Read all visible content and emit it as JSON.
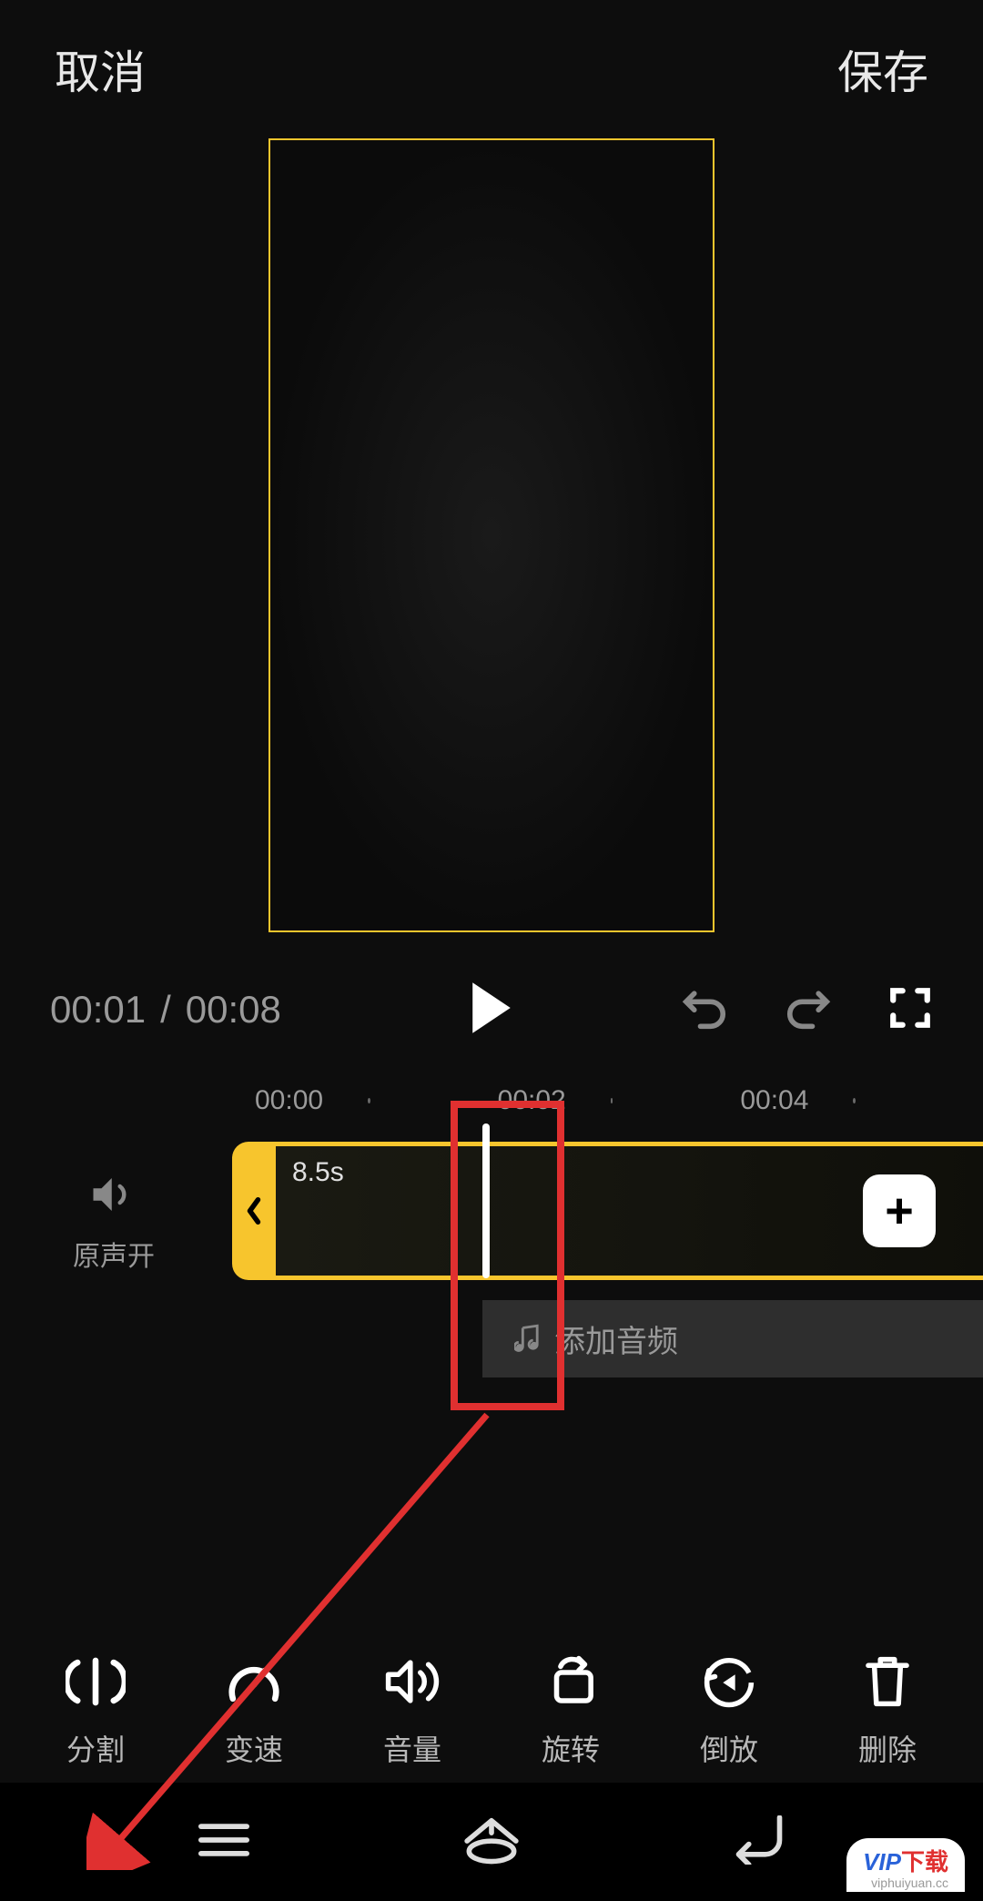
{
  "header": {
    "cancel": "取消",
    "save": "保存"
  },
  "playback": {
    "current_time": "00:01",
    "separator": "/",
    "total_time": "00:08"
  },
  "timeline": {
    "markers": [
      "00:00",
      "00:02",
      "00:04"
    ],
    "clip_duration": "8.5s",
    "sound_toggle_label": "原声开",
    "add_audio_label": "添加音频"
  },
  "tools": {
    "split": "分割",
    "speed": "变速",
    "volume": "音量",
    "rotate": "旋转",
    "reverse": "倒放",
    "delete": "删除"
  },
  "watermark": {
    "brand": "VIP",
    "text": "下载",
    "sub": "viphuiyuan.cc"
  },
  "colors": {
    "accent": "#f7c52d",
    "annotation": "#e03030"
  }
}
